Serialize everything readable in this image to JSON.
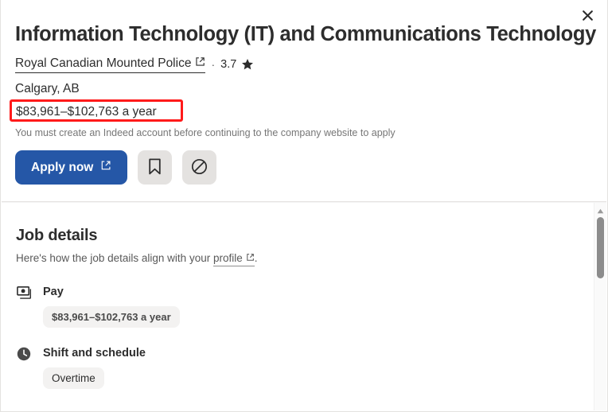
{
  "panel": {
    "close_label": "×"
  },
  "header": {
    "job_title": "Information Technology (IT) and Communications Technology",
    "company_name": "Royal Canadian Mounted Police",
    "separator": "·",
    "rating": "3.7",
    "location": "Calgary, AB",
    "salary": "$83,961–$102,763 a year",
    "apply_note": "You must create an Indeed account before continuing to the company website to apply",
    "apply_button": "Apply now"
  },
  "job_details": {
    "title": "Job details",
    "subtitle_before": "Here's how the job details align with your ",
    "subtitle_link": "profile",
    "subtitle_after": ".",
    "groups": [
      {
        "icon": "pay-icon",
        "label": "Pay",
        "badges": [
          "$83,961–$102,763 a year"
        ]
      },
      {
        "icon": "clock-icon",
        "label": "Shift and schedule",
        "badges": [
          "Overtime"
        ]
      }
    ]
  },
  "colors": {
    "accent_blue": "#2557a7",
    "highlight_red": "#ff1a1a",
    "badge_bg": "#f3f2f1",
    "icon_btn_bg": "#e4e2e0",
    "text_primary": "#2d2d2d",
    "text_muted": "#767676"
  }
}
